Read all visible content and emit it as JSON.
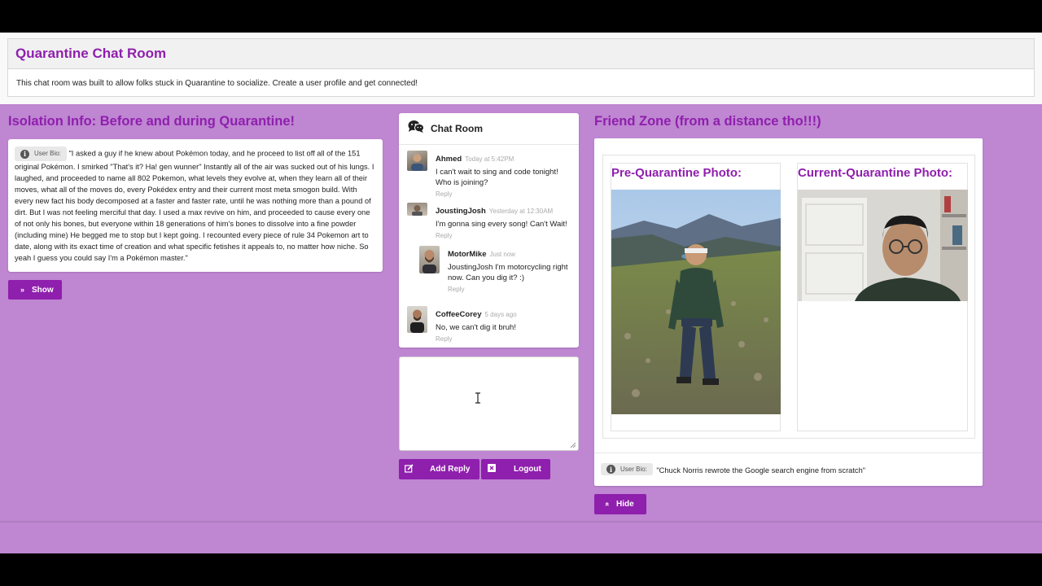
{
  "header": {
    "title": "Quarantine Chat Room",
    "description": "This chat room was built to allow folks stuck in Quarantine to socialize. Create a user profile and get connected!"
  },
  "isolation": {
    "title": "Isolation Info: Before and during Quarantine!",
    "bio_label": "User Bio:",
    "bio_text": "\"I asked a guy if he knew about Pokémon today, and he proceed to list off all of the 151 original Pokémon. I smirked \"That's it? Ha! gen wunner\" Instantly all of the air was sucked out of his lungs. I laughed, and proceeded to name all 802 Pokemon, what levels they evolve at, when they learn all of their moves, what all of the moves do, every Pokédex entry and their current most meta smogon build. With every new fact his body decomposed at a faster and faster rate, until he was nothing more than a pound of dirt. But I was not feeling merciful that day. I used a max revive on him, and proceeded to cause every one of not only his bones, but everyone within 18 generations of him's bones to dissolve into a fine powder (including mine) He begged me to stop but I kept going. I recounted every piece of rule 34 Pokemon art to date, along with its exact time of creation and what specific fetishes it appeals to, no matter how niche. So yeah I guess you could say I'm a Pokémon master.\"",
    "show_label": "Show"
  },
  "chat": {
    "title": "Chat Room",
    "comments": [
      {
        "author": "Ahmed",
        "meta": "Today at 5:42PM",
        "text": "I can't wait to sing and code tonight! Who is joining?",
        "reply": "Reply"
      },
      {
        "author": "JoustingJosh",
        "meta": "Yesterday at 12:30AM",
        "text": "I'm gonna sing every song! Can't Wait!",
        "reply": "Reply"
      },
      {
        "author": "MotorMike",
        "meta": "Just now",
        "text": "JoustingJosh I'm motorcycling right now. Can you dig it? :)",
        "reply": "Reply"
      },
      {
        "author": "CoffeeCorey",
        "meta": "5 days ago",
        "text": "No, we can't dig it bruh!",
        "reply": "Reply"
      }
    ],
    "add_reply_label": "Add Reply",
    "logout_label": "Logout"
  },
  "friend_zone": {
    "title": "Friend Zone (from a distance tho!!!)",
    "pre_photo_title": "Pre-Quarantine Photo:",
    "current_photo_title": "Current-Quarantine Photo:",
    "bio_label": "User Bio:",
    "bio_text": "\"Chuck Norris rewrote the Google search engine from scratch\"",
    "hide_label": "Hide"
  }
}
